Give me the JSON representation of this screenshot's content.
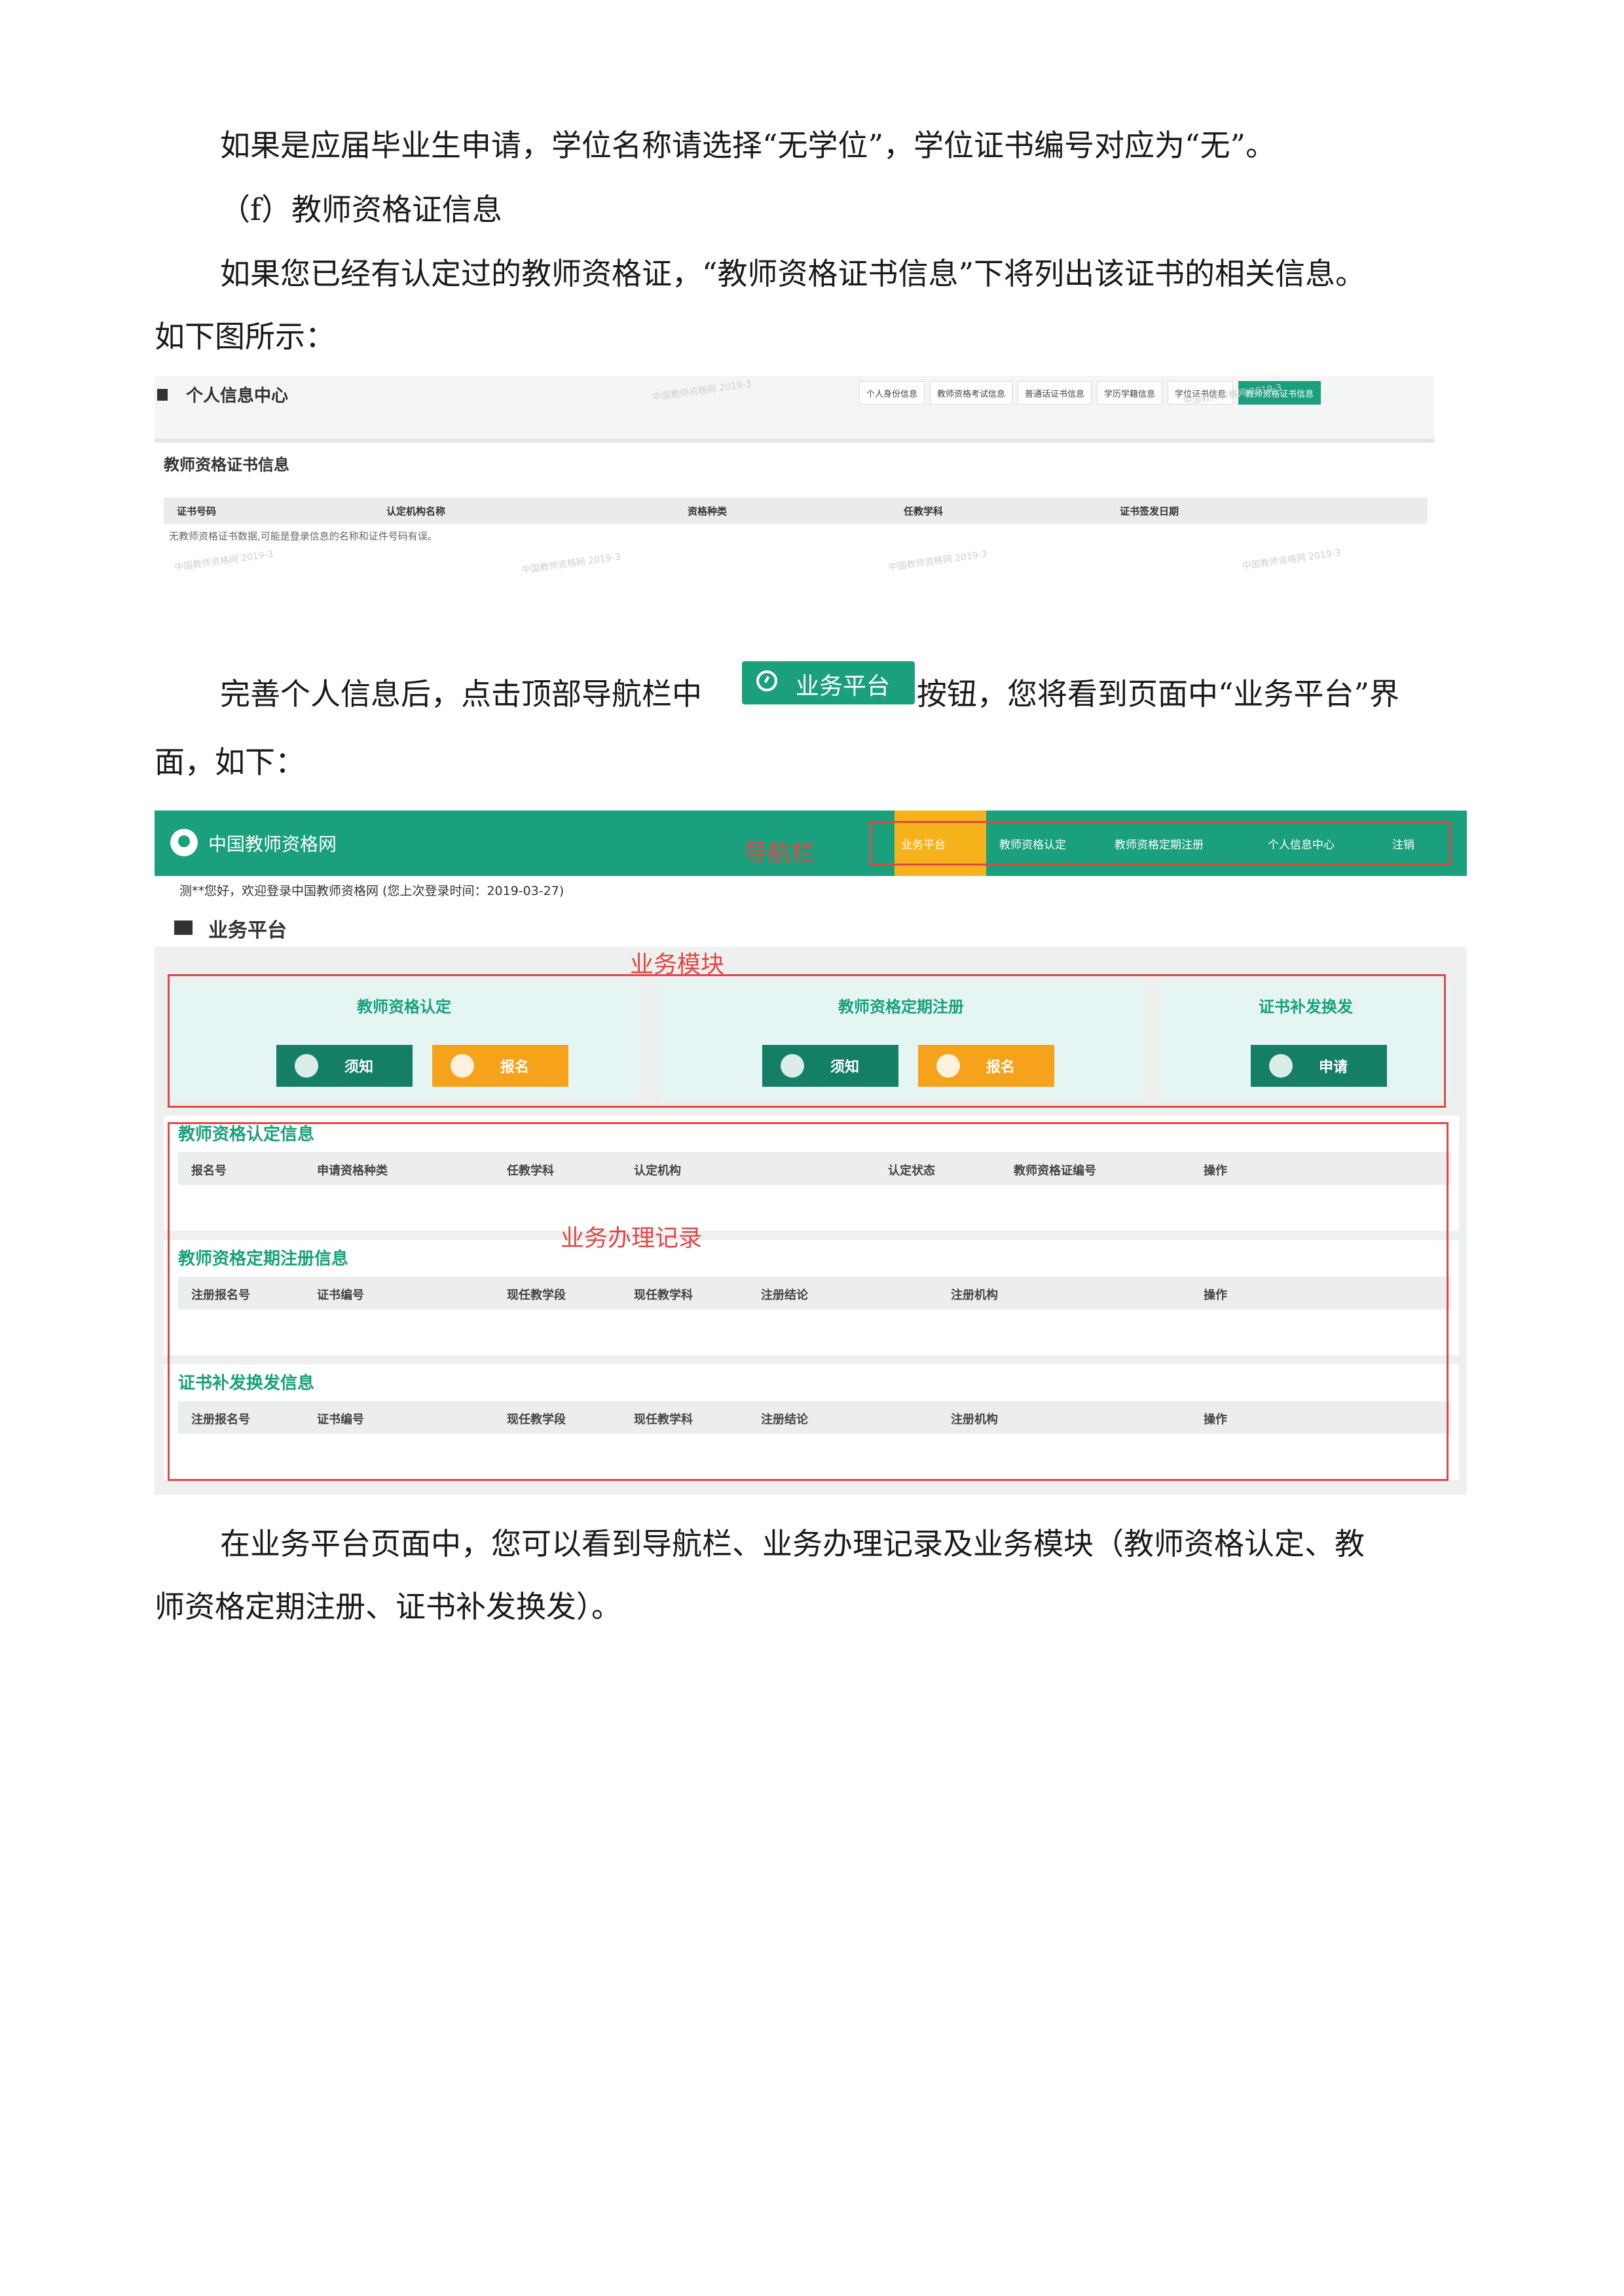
{
  "paragraphs": {
    "p1": "如果是应届毕业生申请，学位名称请选择“无学位”，学位证书编号对应为“无”。",
    "p2": "（f）教师资格证信息",
    "p3": "如果您已经有认定过的教师资格证，“教师资格证书信息”下将列出该证书的相关信息。",
    "p4": "如下图所示：",
    "p5a": "完善个人信息后，点击顶部导航栏中",
    "p5b": "按钮，您将看到页面中“业务平台”界",
    "p6": "面，如下：",
    "p7": "在业务平台页面中，您可以看到导航栏、业务办理记录及业务模块（教师资格认定、教",
    "p8": "师资格定期注册、证书补发换发）。"
  },
  "inline_button": {
    "label": "业务平台",
    "icon": "dashboard-icon",
    "color": "#1aa07c"
  },
  "figure1": {
    "title": "个人信息中心",
    "tabs": [
      "个人身份信息",
      "教师资格考试信息",
      "普通话证书信息",
      "学历学籍信息",
      "学位证书信息",
      "教师资格证书信息"
    ],
    "section_title": "教师资格证书信息",
    "columns": [
      "证书号码",
      "认定机构名称",
      "资格种类",
      "任教学科",
      "证书签发日期"
    ],
    "empty_text": "无教师资格证书数据,可能是登录信息的名称和证件号码有误。",
    "watermark": "中国教师资格网 2019-3"
  },
  "figure2": {
    "site_name": "中国教师资格网",
    "nav": [
      "业务平台",
      "教师资格认定",
      "教师资格定期注册",
      "个人信息中心",
      "注销"
    ],
    "nav_annotation": "导航栏",
    "welcome": "测**您好，欢迎登录中国教师资格网 (您上次登录时间：2019-03-27)",
    "page_title": "业务平台",
    "modules_annotation": "业务模块",
    "modules": [
      {
        "title": "教师资格认定",
        "buttons": [
          "须知",
          "报名"
        ]
      },
      {
        "title": "教师资格定期注册",
        "buttons": [
          "须知",
          "报名"
        ]
      },
      {
        "title": "证书补发换发",
        "buttons": [
          "申请"
        ]
      }
    ],
    "records_annotation": "业务办理记录",
    "records": [
      {
        "title": "教师资格认定信息",
        "columns": [
          "报名号",
          "申请资格种类",
          "任教学科",
          "认定机构",
          "认定状态",
          "教师资格证编号",
          "操作"
        ]
      },
      {
        "title": "教师资格定期注册信息",
        "columns": [
          "注册报名号",
          "证书编号",
          "现任教学段",
          "现任教学科",
          "注册结论",
          "注册机构",
          "操作"
        ]
      },
      {
        "title": "证书补发换发信息",
        "columns": [
          "注册报名号",
          "证书编号",
          "现任教学段",
          "现任教学科",
          "注册结论",
          "注册机构",
          "操作"
        ]
      }
    ],
    "colors": {
      "brand": "#1aa07c",
      "accent": "#f6a21b",
      "annotation": "#e04848"
    }
  }
}
